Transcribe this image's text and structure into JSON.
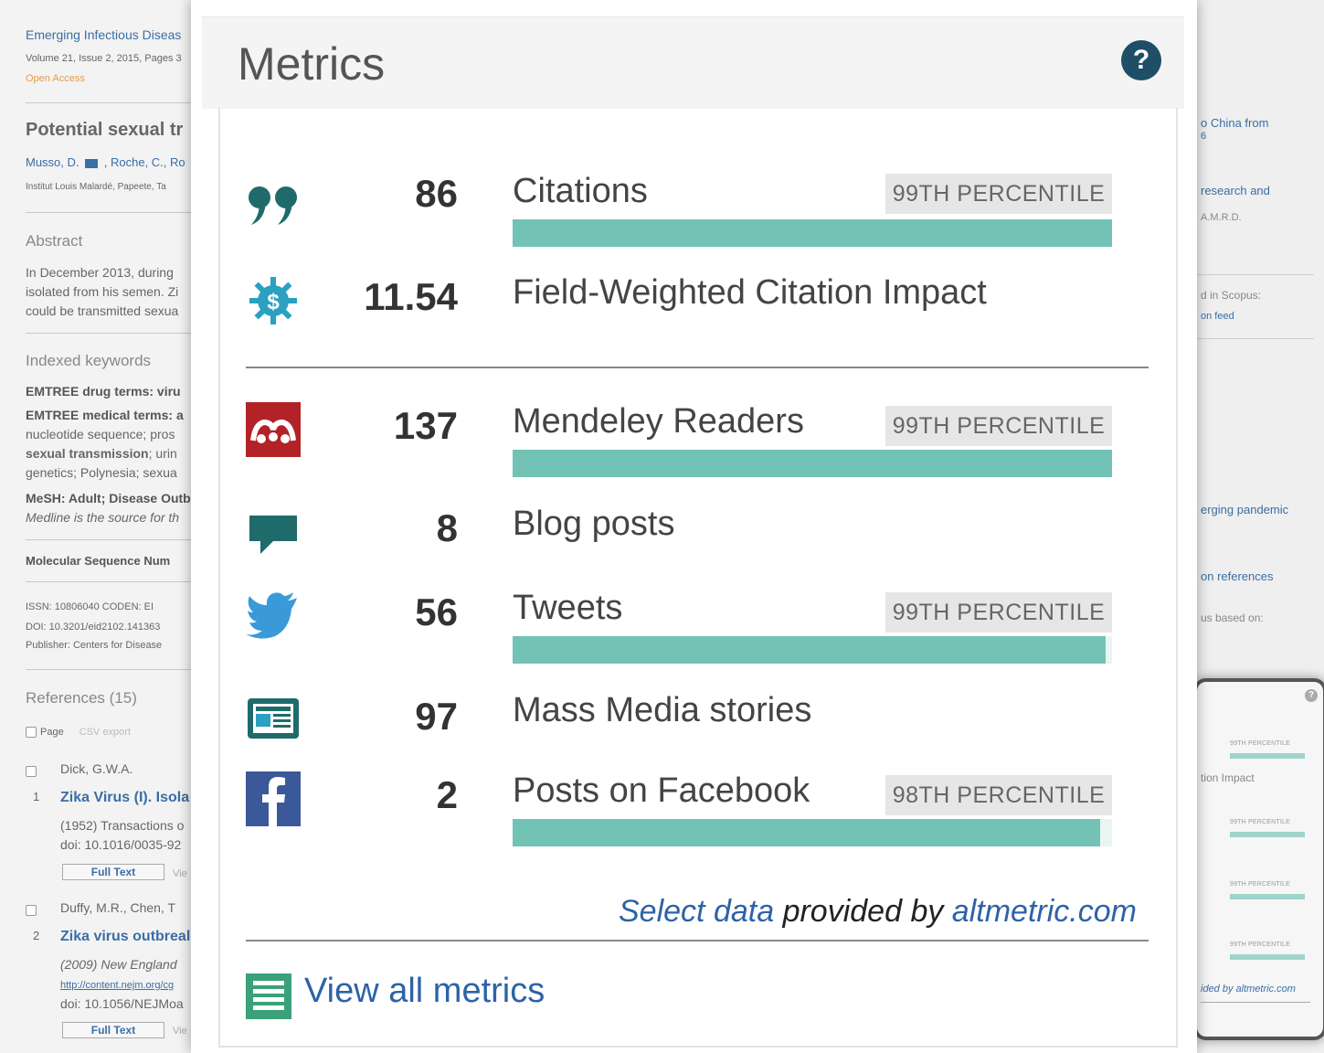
{
  "background": {
    "journal": "Emerging Infectious Diseas",
    "volume": "Volume 21, Issue 2, 2015, Pages 3",
    "open_access": "Open Access",
    "article_title": "Potential sexual tr",
    "authors": "Musso, D.",
    "authors_more": ", Roche, C., Ro",
    "affiliation": "Institut Louis Malardé, Papeete, Ta",
    "abstract_heading": "Abstract",
    "abstract_lines": [
      "In December 2013, during",
      "isolated from his semen. Zi",
      "could be transmitted sexua"
    ],
    "keywords_heading": "Indexed keywords",
    "emtree_drug": "EMTREE drug terms: viru",
    "emtree_medical": "EMTREE medical terms: a",
    "kw_line1": "nucleotide sequence; pros",
    "kw_line2_bold": "sexual transmission",
    "kw_line2_rest": "; urin",
    "kw_line3": "genetics; Polynesia; sexua",
    "mesh": "MeSH: Adult; Disease Outb",
    "medline": "Medline is the source for th",
    "molecular": "Molecular Sequence Num",
    "issn": "ISSN: 10806040    CODEN: EI",
    "doi": "DOI: 10.3201/eid2102.141363",
    "publisher": "Publisher: Centers for Disease",
    "references_heading": "References (15)",
    "page_label": "Page",
    "csv_export": "CSV export",
    "ref1_author": "Dick, G.W.A.",
    "ref1_num": "1",
    "ref1_title": "Zika Virus (I). Isola",
    "ref1_year": "(1952) Transactions o",
    "ref1_doi": "doi: 10.1016/0035-92",
    "full_text": "Full Text",
    "view": "Vie",
    "ref2_author": "Duffy, M.R., Chen, T",
    "ref2_num": "2",
    "ref2_title": "Zika virus outbreal",
    "ref2_year": "(2009) New England",
    "ref2_url": "http://content.nejm.org/cg",
    "ref2_doi": "doi: 10.1056/NEJMoa"
  },
  "right_panel": {
    "item1_line1": "o China from",
    "item1_line2": "6",
    "item2": "research and",
    "item2_authors": "A.M.R.D.",
    "scopus": "d in Scopus:",
    "feed": "on feed",
    "pandemic": "erging pandemic",
    "references": "on references",
    "based_on": "us based on:",
    "mini_help": "?",
    "mini_pct": "99TH PERCENTILE",
    "mini_impact": "tion Impact",
    "mini_footer": "ided by altmetric.com"
  },
  "popup": {
    "title": "Metrics",
    "help_label": "?",
    "rows": [
      {
        "icon": "quote-icon",
        "value": "86",
        "label": "Citations",
        "percentile": "99TH PERCENTILE",
        "bar_fraction": 1.0
      },
      {
        "icon": "fwci-icon",
        "value": "11.54",
        "label": "Field-Weighted Citation Impact"
      },
      {
        "icon": "mendeley-icon",
        "value": "137",
        "label": "Mendeley Readers",
        "percentile": "99TH PERCENTILE",
        "bar_fraction": 1.0
      },
      {
        "icon": "blog-icon",
        "value": "8",
        "label": "Blog posts"
      },
      {
        "icon": "twitter-icon",
        "value": "56",
        "label": "Tweets",
        "percentile": "99TH PERCENTILE",
        "bar_fraction": 0.99
      },
      {
        "icon": "news-icon",
        "value": "97",
        "label": "Mass Media stories"
      },
      {
        "icon": "facebook-icon",
        "value": "2",
        "label": "Posts on Facebook",
        "percentile": "98TH PERCENTILE",
        "bar_fraction": 0.98
      }
    ],
    "provider_prefix": "Select data",
    "provider_middle": " provided by ",
    "provider_link": "altmetric.com",
    "view_all": "View all metrics"
  },
  "colors": {
    "bar_fill": "#72c2b6",
    "icon_teal": "#1f6b6b",
    "mendeley_red": "#b22226",
    "twitter_blue": "#3a9ad9",
    "facebook_blue": "#3b5998",
    "help_bg": "#1e4f66",
    "link": "#2e62a8"
  }
}
